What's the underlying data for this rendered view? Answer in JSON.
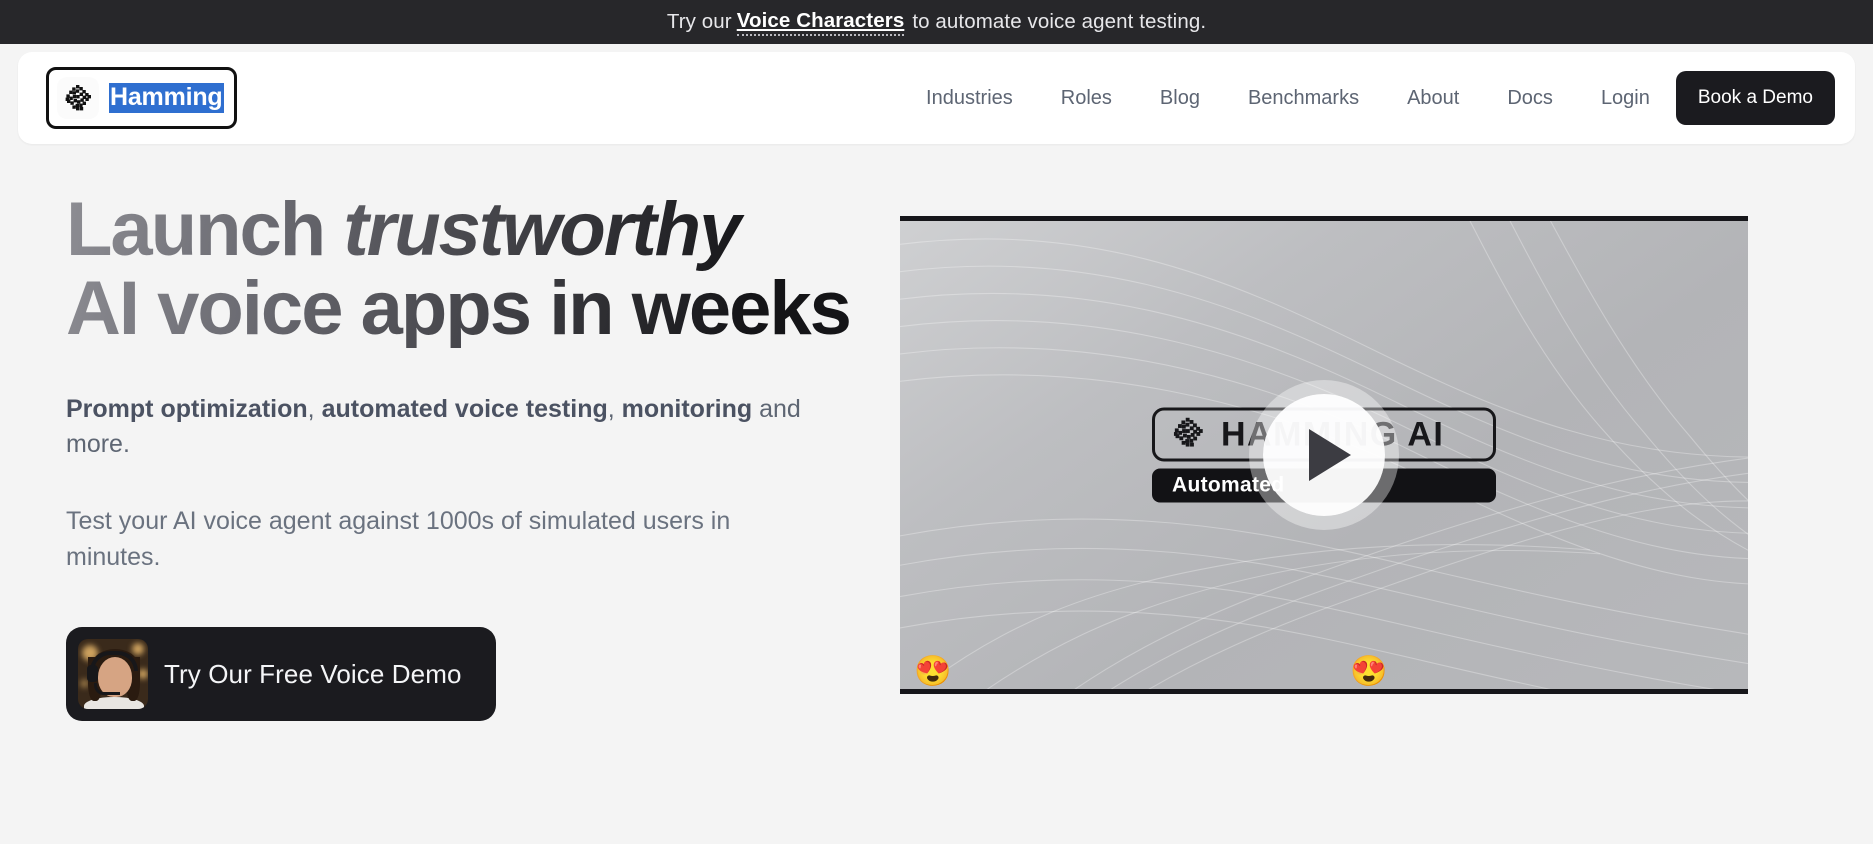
{
  "banner": {
    "prefix": "Try our",
    "link_text": "Voice Characters",
    "suffix": "to automate voice agent testing."
  },
  "header": {
    "logo": {
      "icon": "maze-logo-icon",
      "word": "Hamming",
      "selected": true
    },
    "nav": [
      {
        "label": "Industries",
        "name": "nav-item-industries"
      },
      {
        "label": "Roles",
        "name": "nav-item-roles"
      },
      {
        "label": "Blog",
        "name": "nav-item-blog"
      },
      {
        "label": "Benchmarks",
        "name": "nav-item-benchmarks"
      },
      {
        "label": "About",
        "name": "nav-item-about"
      },
      {
        "label": "Docs",
        "name": "nav-item-docs"
      },
      {
        "label": "Login",
        "name": "nav-item-login"
      }
    ],
    "cta_label": "Book a Demo"
  },
  "hero": {
    "headline_line1_a": "Launch ",
    "headline_line1_italic": "trustworthy",
    "headline_line2": "AI voice apps in weeks",
    "subhead": {
      "b1": "Prompt optimization",
      "sep1": ", ",
      "b2": "automated voice testing",
      "sep2": ", ",
      "b3": "monitoring",
      "tail": " and more."
    },
    "lede": "Test your AI voice agent against 1000s of simulated users in minutes.",
    "voice_cta": {
      "label": "Try Our Free Voice Demo",
      "avatar": "headset-agent-avatar"
    }
  },
  "video": {
    "brand_text": "HAMMING AI",
    "brand_icon": "maze-logo-icon",
    "tagline": "Automated",
    "play_label": "play-button",
    "reactions": [
      "😍",
      "😍"
    ]
  },
  "colors": {
    "page_bg": "#f4f4f4",
    "banner_bg": "#27272a",
    "accent_dark": "#1b1b1f",
    "selection_blue": "#2f6fd0",
    "nav_text": "#5d6573"
  }
}
